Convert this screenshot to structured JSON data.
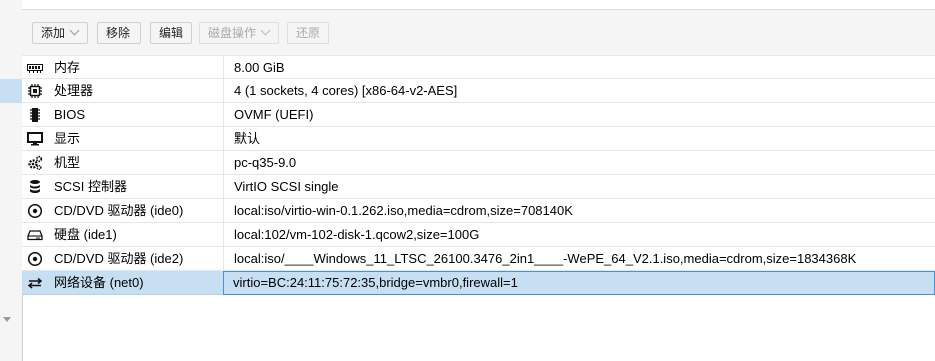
{
  "toolbar": {
    "add_label": "添加",
    "remove_label": "移除",
    "edit_label": "编辑",
    "disk_action_label": "磁盘操作",
    "revert_label": "还原"
  },
  "hardware": [
    {
      "icon": "memory-icon",
      "key": "内存",
      "value": "8.00 GiB"
    },
    {
      "icon": "cpu-icon",
      "key": "处理器",
      "value": "4 (1 sockets, 4 cores) [x86-64-v2-AES]"
    },
    {
      "icon": "bios-chip-icon",
      "key": "BIOS",
      "value": "OVMF (UEFI)"
    },
    {
      "icon": "monitor-icon",
      "key": "显示",
      "value": "默认"
    },
    {
      "icon": "gears-icon",
      "key": "机型",
      "value": "pc-q35-9.0"
    },
    {
      "icon": "database-icon",
      "key": "SCSI 控制器",
      "value": "VirtIO SCSI single"
    },
    {
      "icon": "cdrom-icon",
      "key": "CD/DVD 驱动器 (ide0)",
      "value": "local:iso/virtio-win-0.1.262.iso,media=cdrom,size=708140K"
    },
    {
      "icon": "hdd-icon",
      "key": "硬盘 (ide1)",
      "value": "local:102/vm-102-disk-1.qcow2,size=100G"
    },
    {
      "icon": "cdrom-icon",
      "key": "CD/DVD 驱动器 (ide2)",
      "value": "local:iso/____Windows_11_LTSC_26100.3476_2in1____-WePE_64_V2.1.iso,media=cdrom,size=1834368K"
    },
    {
      "icon": "network-exchange-icon",
      "key": "网络设备 (net0)",
      "value": "virtio=BC:24:11:75:72:35,bridge=vmbr0,firewall=1"
    }
  ],
  "selected_row": 9,
  "colors": {
    "selection": "#c7dff2",
    "selection_border": "#4a90d9"
  }
}
